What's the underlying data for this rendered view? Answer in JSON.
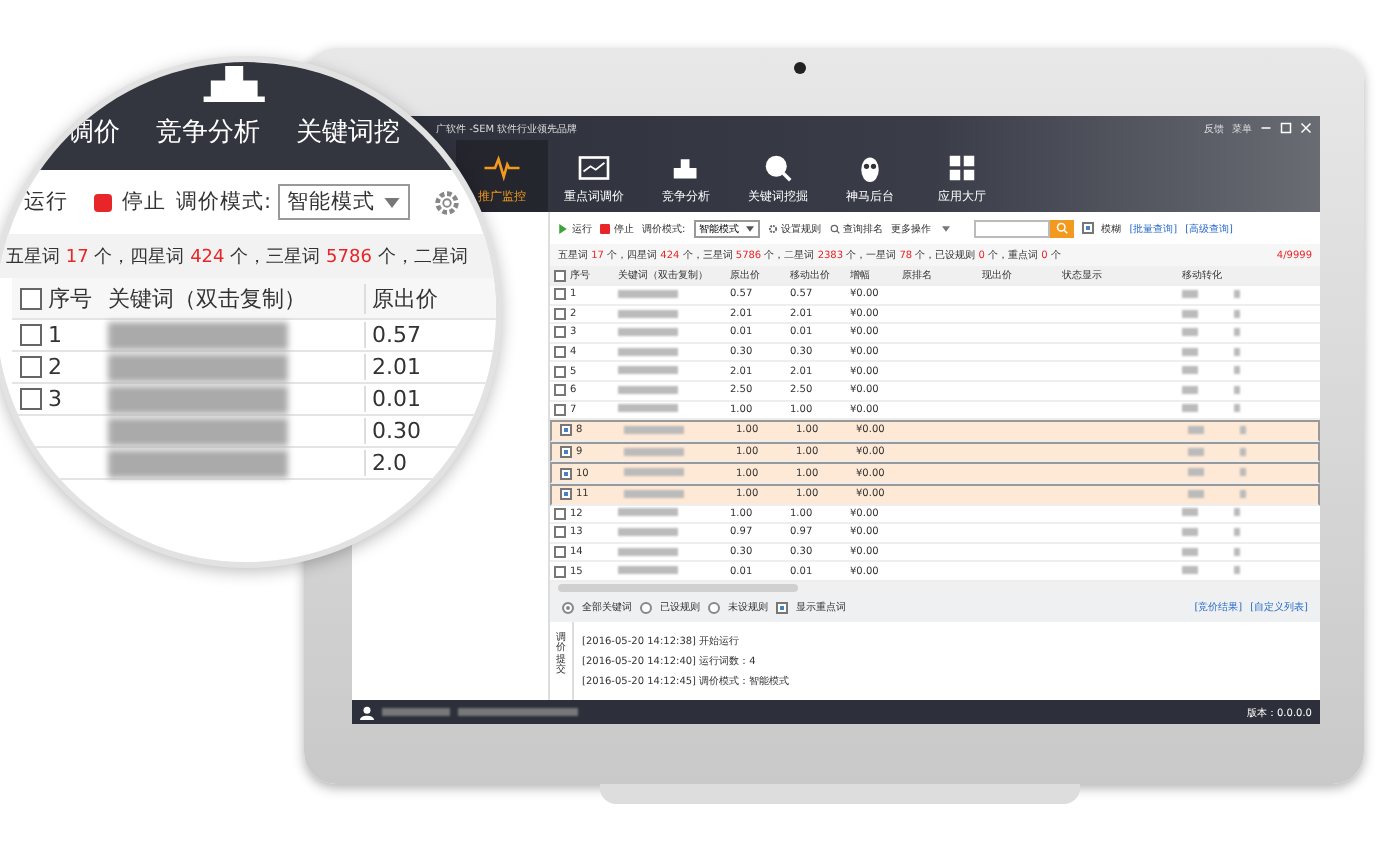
{
  "app": {
    "title": "广软件 -SEM 软件行业领先品牌",
    "top_actions": [
      "反馈",
      "菜单"
    ],
    "nav": [
      {
        "label": "推广监控",
        "selected": true,
        "kind": "pulse"
      },
      {
        "label": "重点词调价",
        "selected": false,
        "kind": "chart"
      },
      {
        "label": "竞争分析",
        "selected": false,
        "kind": "podium"
      },
      {
        "label": "关键词挖掘",
        "selected": false,
        "kind": "search"
      },
      {
        "label": "神马后台",
        "selected": false,
        "kind": "owl"
      },
      {
        "label": "应用大厅",
        "selected": false,
        "kind": "grid"
      }
    ],
    "toolbar": {
      "run": "运行",
      "stop": "停止",
      "mode_label": "调价模式:",
      "mode": "智能模式",
      "rules": "设置规则",
      "rank": "查询排名",
      "more": "更多操作",
      "fuzzy": {
        "label": "模糊",
        "checked": true
      },
      "links": [
        "[批量查询]",
        "[高级查询]"
      ]
    },
    "stats": [
      {
        "label": "五星词",
        "count": "17",
        "unit": "个，"
      },
      {
        "label": "四星词",
        "count": "424",
        "unit": "个，"
      },
      {
        "label": "三星词",
        "count": "5786",
        "unit": "个，"
      },
      {
        "label": "二星词",
        "count": "2383",
        "unit": "个，"
      },
      {
        "label": "一星词",
        "count": "78",
        "unit": "个，"
      },
      {
        "label": "已设规则",
        "count": "0",
        "unit": "个，"
      },
      {
        "label": "重点词",
        "count": "0",
        "unit": "个"
      }
    ],
    "quota": "4/9999",
    "table": {
      "all_checked": false,
      "columns": [
        "序号",
        "关键词（双击复制）",
        "原出价",
        "移动出价",
        "增幅",
        "原排名",
        "现出价",
        "状态显示",
        "移动转化"
      ],
      "rows": [
        {
          "no": "1",
          "price": "0.57",
          "mobile": "0.57",
          "delta": "¥0.00",
          "selected": false
        },
        {
          "no": "2",
          "price": "2.01",
          "mobile": "2.01",
          "delta": "¥0.00",
          "selected": false
        },
        {
          "no": "3",
          "price": "0.01",
          "mobile": "0.01",
          "delta": "¥0.00",
          "selected": false
        },
        {
          "no": "4",
          "price": "0.30",
          "mobile": "0.30",
          "delta": "¥0.00",
          "selected": false
        },
        {
          "no": "5",
          "price": "2.01",
          "mobile": "2.01",
          "delta": "¥0.00",
          "selected": false
        },
        {
          "no": "6",
          "price": "2.50",
          "mobile": "2.50",
          "delta": "¥0.00",
          "selected": false
        },
        {
          "no": "7",
          "price": "1.00",
          "mobile": "1.00",
          "delta": "¥0.00",
          "selected": false
        },
        {
          "no": "8",
          "price": "1.00",
          "mobile": "1.00",
          "delta": "¥0.00",
          "selected": true
        },
        {
          "no": "9",
          "price": "1.00",
          "mobile": "1.00",
          "delta": "¥0.00",
          "selected": true
        },
        {
          "no": "10",
          "price": "1.00",
          "mobile": "1.00",
          "delta": "¥0.00",
          "selected": true
        },
        {
          "no": "11",
          "price": "1.00",
          "mobile": "1.00",
          "delta": "¥0.00",
          "selected": true
        },
        {
          "no": "12",
          "price": "1.00",
          "mobile": "1.00",
          "delta": "¥0.00",
          "selected": false
        },
        {
          "no": "13",
          "price": "0.97",
          "mobile": "0.97",
          "delta": "¥0.00",
          "selected": false
        },
        {
          "no": "14",
          "price": "0.30",
          "mobile": "0.30",
          "delta": "¥0.00",
          "selected": false
        },
        {
          "no": "15",
          "price": "0.01",
          "mobile": "0.01",
          "delta": "¥0.00",
          "selected": false
        }
      ]
    },
    "filters": [
      {
        "label": "全部关键词",
        "selected": true
      },
      {
        "label": "已设规则",
        "selected": false
      },
      {
        "label": "未设规则",
        "selected": false
      }
    ],
    "show_key": {
      "label": "显示重点词",
      "checked": true
    },
    "bottom_links": [
      "[竞价结果]",
      "[自定义列表]"
    ],
    "log_label": "调价提交",
    "log": [
      "[2016-05-20 14:12:38]  开始运行",
      "[2016-05-20 14:12:40]  运行词数：4",
      "[2016-05-20 14:12:45]  调价模式：智能模式"
    ],
    "version": "版本：0.0.0.0"
  },
  "magnifier": {
    "nav": [
      "调价",
      "竞争分析",
      "关键词挖"
    ],
    "run": "运行",
    "stop": "停止",
    "mode_label": "调价模式:",
    "mode": "智能模式",
    "stats": [
      {
        "label": "五星词",
        "count": "17",
        "unit": "个，"
      },
      {
        "label": "四星词",
        "count": "424",
        "unit": "个，"
      },
      {
        "label": "三星词",
        "count": "5786",
        "unit": "个，"
      },
      {
        "label": "二星词"
      }
    ],
    "all_checked": false,
    "columns": [
      "序号",
      "关键词（双击复制）",
      "原出价"
    ],
    "rows": [
      {
        "no": "1",
        "price": "0.57",
        "checked": false
      },
      {
        "no": "2",
        "price": "2.01",
        "checked": false
      },
      {
        "no": "3",
        "price": "0.01",
        "checked": false
      },
      {
        "price": "0.30"
      },
      {
        "price": "2.0"
      }
    ]
  }
}
